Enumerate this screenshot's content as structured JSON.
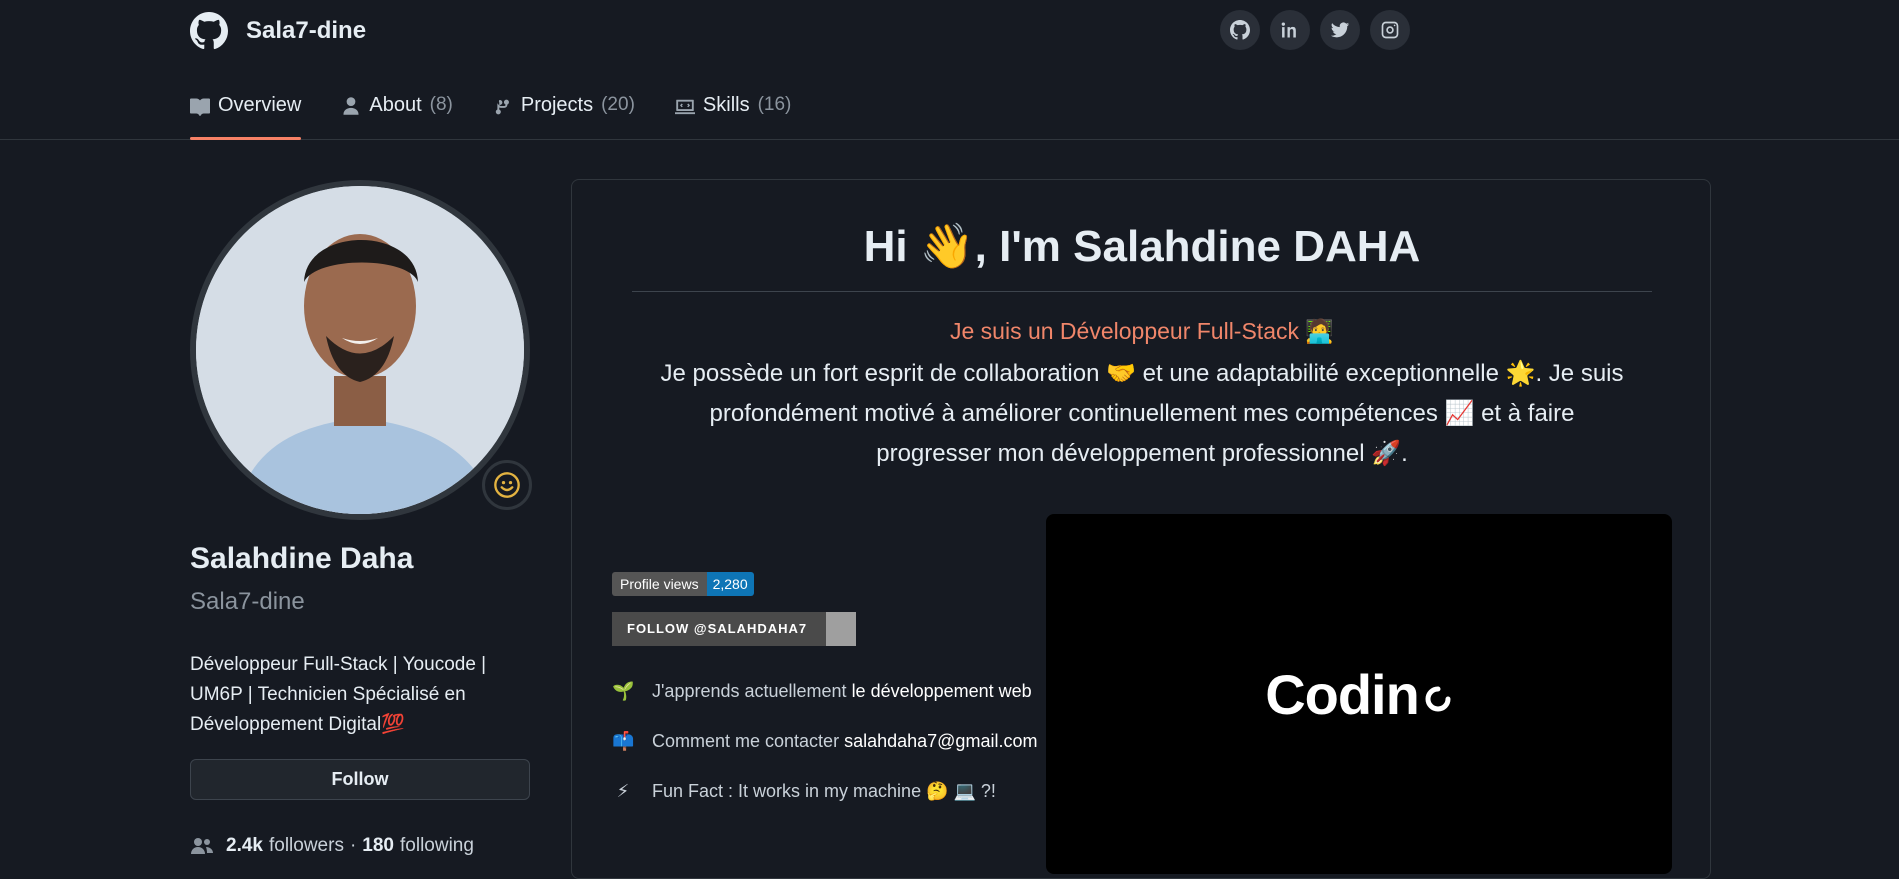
{
  "header": {
    "username": "Sala7-dine",
    "socials": [
      "github-icon",
      "linkedin-icon",
      "twitter-icon",
      "instagram-icon"
    ]
  },
  "tabs": [
    {
      "label": "Overview",
      "count": "",
      "active": true
    },
    {
      "label": "About",
      "count": "(8)"
    },
    {
      "label": "Projects",
      "count": "(20)"
    },
    {
      "label": "Skills",
      "count": "(16)"
    }
  ],
  "profile": {
    "name": "Salahdine Daha",
    "login": "Sala7-dine",
    "bio": "Développeur Full-Stack | Youcode | UM6P | Technicien Spécialisé en Développement Digital💯",
    "follow_label": "Follow",
    "followers": "2.4k",
    "followers_label": "followers",
    "separator": "·",
    "following": "180",
    "following_label": "following",
    "status_emoji": "☺"
  },
  "readme": {
    "title": "Hi 👋, I'm Salahdine DAHA",
    "tagline": "Je suis un Développeur Full-Stack 🧑‍💻",
    "intro": "Je possède un fort esprit de collaboration 🤝 et une adaptabilité exceptionnelle 🌟. Je suis profondément motivé à améliorer continuellement mes compétences 📈 et à faire progresser mon développement professionnel 🚀.",
    "views_label": "Profile views",
    "views_count": "2,280",
    "follow_badge": "FOLLOW @SALAHDAHA7",
    "facts": [
      {
        "icon": "🌱",
        "text": "J'apprends actuellement",
        "highlight": "le développement web"
      },
      {
        "icon": "📫",
        "text": "Comment me contacter",
        "highlight": "salahdaha7@gmail.com"
      },
      {
        "icon": "⚡",
        "text": "Fun Fact : It works in my machine 🤔 💻 ?!",
        "highlight": ""
      }
    ],
    "video_text": "Codin"
  },
  "colors": {
    "background": "#161a22",
    "accent_tab": "#f78166",
    "tagline": "#f0866a",
    "views_badge": "#0e75b6"
  }
}
